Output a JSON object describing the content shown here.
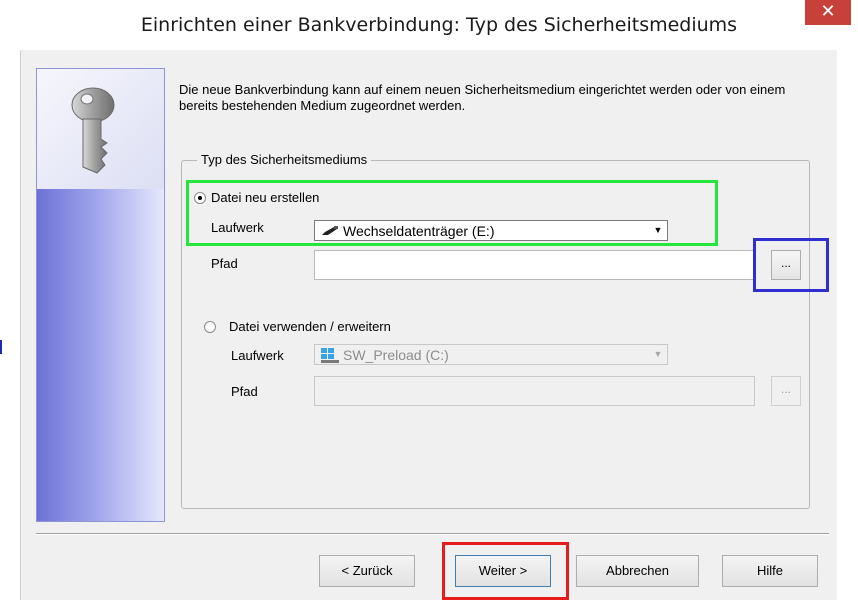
{
  "window": {
    "title": "Einrichten einer Bankverbindung: Typ des Sicherheitsmediums",
    "close_label": "✕"
  },
  "intro_text": "Die neue Bankverbindung kann  auf einem neuen Sicherheitsmedium eingerichtet werden oder von einem bereits bestehenden Medium zugeordnet werden.",
  "group": {
    "legend": "Typ des Sicherheitsmediums",
    "option_new": {
      "label": "Datei neu erstellen",
      "selected": true,
      "drive_label": "Laufwerk",
      "drive_value": "Wechseldatenträger (E:)",
      "drive_icon": "removable-drive-icon",
      "path_label": "Pfad",
      "path_value": "",
      "browse_label": "..."
    },
    "option_existing": {
      "label": "Datei verwenden / erweitern",
      "selected": false,
      "drive_label": "Laufwerk",
      "drive_value": "SW_Preload (C:)",
      "drive_icon": "windows-drive-icon",
      "path_label": "Pfad",
      "path_value": "",
      "browse_label": "..."
    }
  },
  "buttons": {
    "back": "< Zurück",
    "next": "Weiter >",
    "cancel": "Abbrechen",
    "help": "Hilfe"
  },
  "highlight_colors": {
    "green": "#26e63d",
    "blue": "#2f2fd0",
    "red": "#e61c1c"
  }
}
